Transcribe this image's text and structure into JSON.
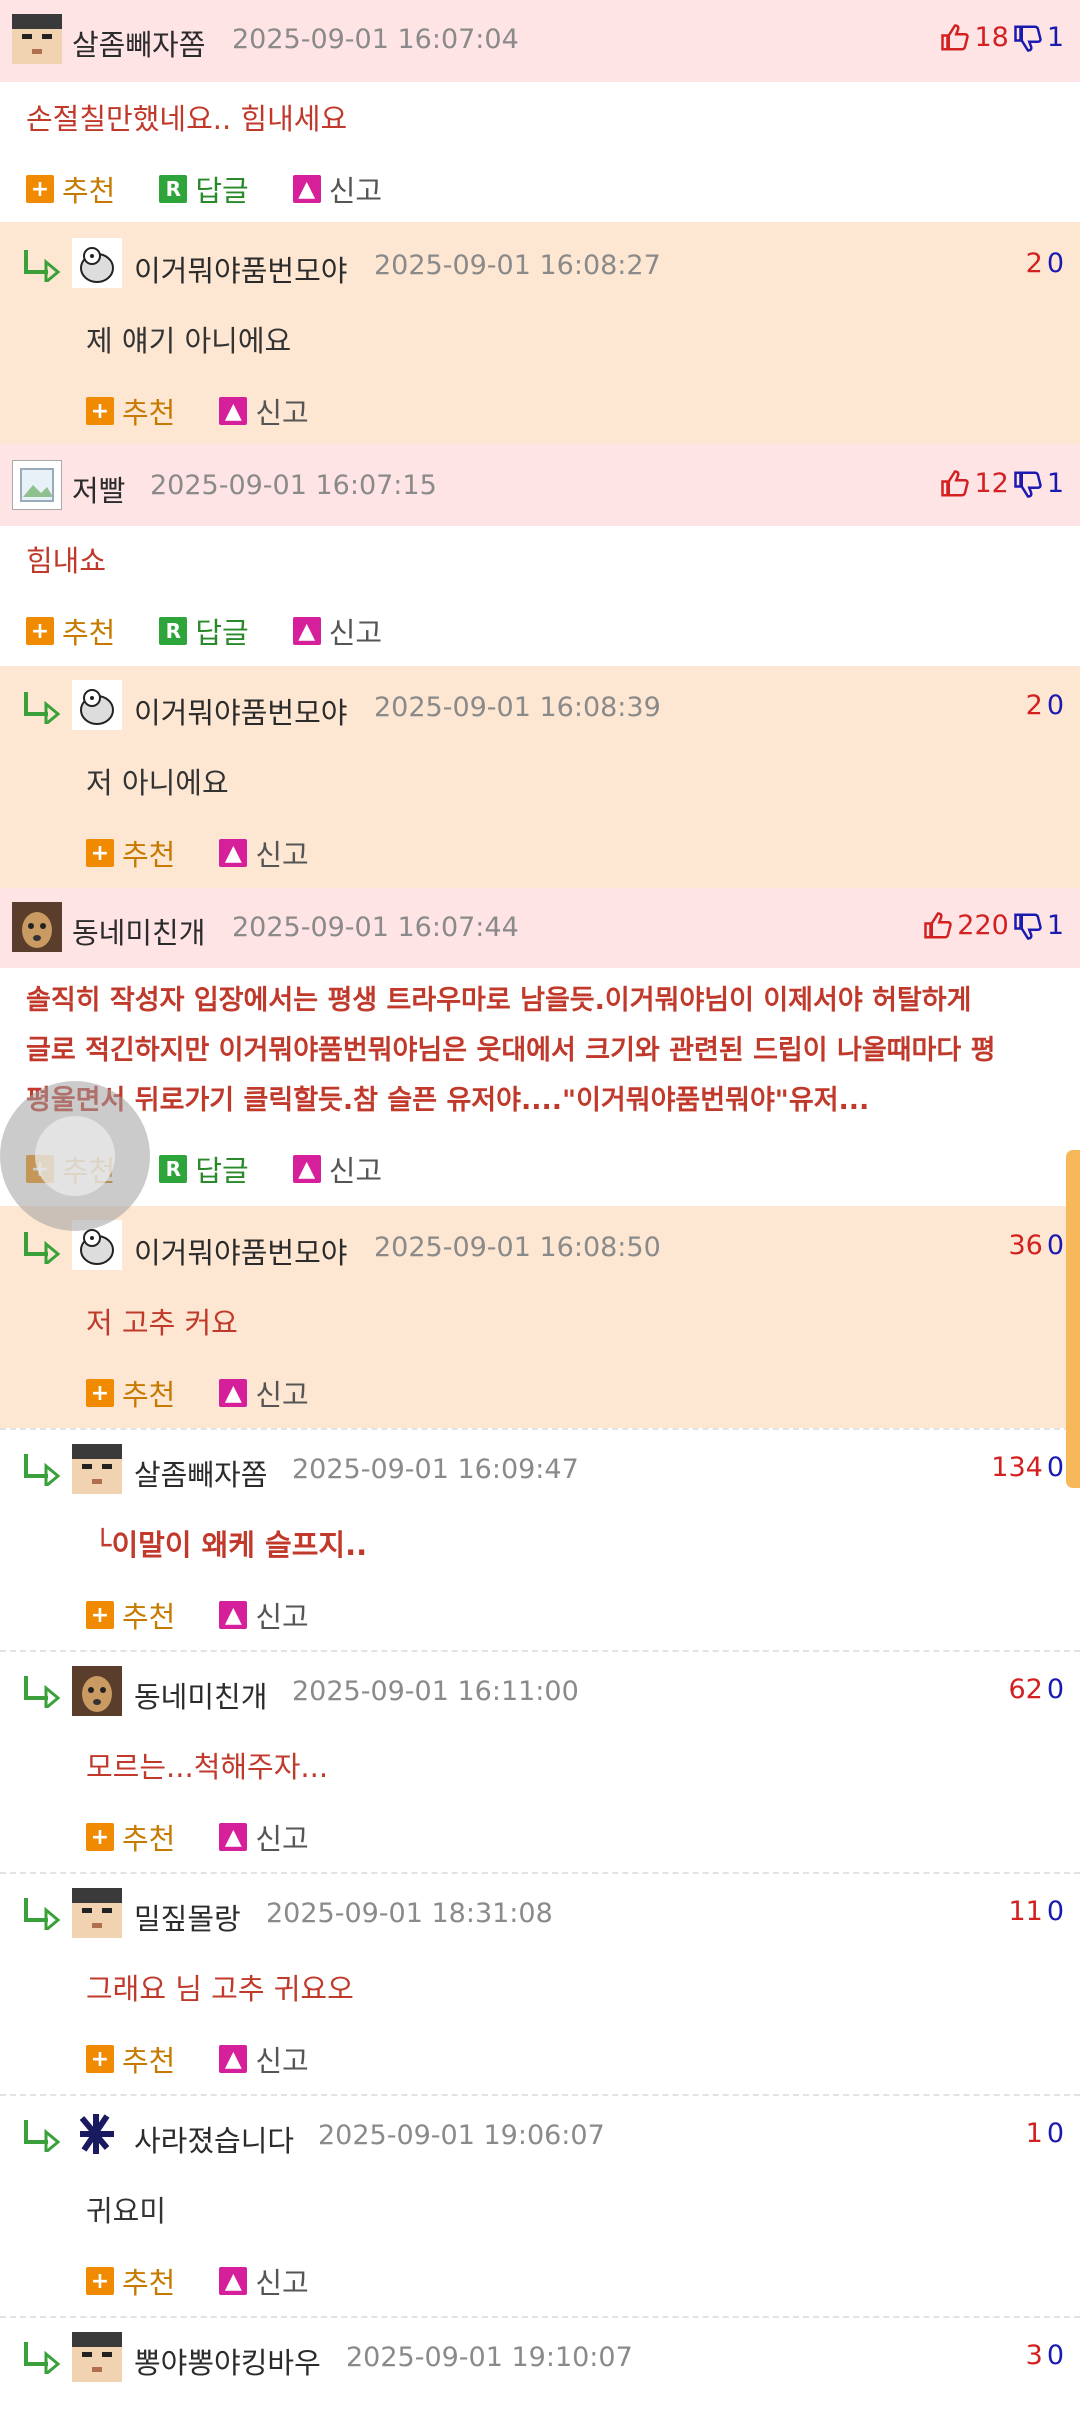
{
  "comments": [
    {
      "kind": "top",
      "author": "살좀빼자쫌",
      "avatar": "pixel-face-avatar",
      "time": "2025-09-01 16:07:04",
      "up": "18",
      "down": "1",
      "body": "손절칠만했네요.. 힘내세요",
      "actions": {
        "recommend": "추천",
        "reply": "답글",
        "report": "신고"
      }
    },
    {
      "kind": "reply",
      "author": "이거뭐야품번모야",
      "avatar": "cartoon-avatar",
      "time": "2025-09-01 16:08:27",
      "up": "2",
      "down": "0",
      "body": "제 얘기 아니에요",
      "actions": {
        "recommend": "추천",
        "report": "신고"
      }
    },
    {
      "kind": "top",
      "author": "저빨",
      "avatar": "broken-image-avatar",
      "time": "2025-09-01 16:07:15",
      "up": "12",
      "down": "1",
      "body": "힘내쇼",
      "actions": {
        "recommend": "추천",
        "reply": "답글",
        "report": "신고"
      }
    },
    {
      "kind": "reply",
      "author": "이거뭐야품번모야",
      "avatar": "cartoon-avatar",
      "time": "2025-09-01 16:08:39",
      "up": "2",
      "down": "0",
      "body": "저 아니에요",
      "actions": {
        "recommend": "추천",
        "report": "신고"
      }
    },
    {
      "kind": "top",
      "author": "동네미친개",
      "avatar": "dog-avatar",
      "time": "2025-09-01 16:07:44",
      "up": "220",
      "down": "1",
      "body_lines": [
        "솔직히 작성자 입장에서는 평생 트라우마로 남을듯.이거뭐야님이 이제서야 허탈하게",
        "글로 적긴하지만 이거뭐야품번뭐야님은 웃대에서 크기와 관련된 드립이 나올때마다 평",
        "평울면서 뒤로가기 클릭할듯.참 슬픈 유저야....\"이거뭐야품번뭐야\"유저..."
      ],
      "actions": {
        "recommend": "추천",
        "reply": "답글",
        "report": "신고"
      }
    },
    {
      "kind": "reply",
      "author": "이거뭐야품번모야",
      "avatar": "cartoon-avatar",
      "time": "2025-09-01 16:08:50",
      "up": "36",
      "down": "0",
      "body": "저 고추 커요",
      "actions": {
        "recommend": "추천",
        "report": "신고"
      }
    },
    {
      "kind": "reply",
      "author": "살좀빼자쫌",
      "avatar": "pixel-face-avatar",
      "time": "2025-09-01 16:09:47",
      "up": "134",
      "down": "0",
      "body": "└이말이 왜케 슬프지..",
      "actions": {
        "recommend": "추천",
        "report": "신고"
      }
    },
    {
      "kind": "reply",
      "author": "동네미친개",
      "avatar": "dog-avatar",
      "time": "2025-09-01 16:11:00",
      "up": "62",
      "down": "0",
      "body": "모르는...척해주자...",
      "actions": {
        "recommend": "추천",
        "report": "신고"
      }
    },
    {
      "kind": "reply",
      "author": "밀짚몰랑",
      "avatar": "pixel-face-avatar",
      "time": "2025-09-01 18:31:08",
      "up": "11",
      "down": "0",
      "body": "그래요 님 고추 귀요오",
      "actions": {
        "recommend": "추천",
        "report": "신고"
      }
    },
    {
      "kind": "reply",
      "author": "사라졌습니다",
      "avatar": "scribble-avatar",
      "time": "2025-09-01 19:06:07",
      "up": "1",
      "down": "0",
      "body": "귀요미",
      "actions": {
        "recommend": "추천",
        "report": "신고"
      }
    },
    {
      "kind": "reply",
      "author": "뽕야뽕야킹바우",
      "avatar": "pixel-face-avatar",
      "time": "2025-09-01 19:10:07",
      "up": "3",
      "down": "0"
    }
  ],
  "colors": {
    "top_header_bg": "#ffe4e6",
    "reply_bg": "#fde7d2",
    "up_vote": "#d32020",
    "down_vote": "#1a1ab0",
    "comment_text": "#c0392b"
  }
}
